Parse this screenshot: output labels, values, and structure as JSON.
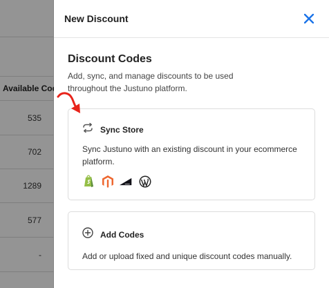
{
  "background": {
    "column_header": "Available Codes",
    "rows": [
      "535",
      "702",
      "1289",
      "577",
      "-"
    ]
  },
  "drawer": {
    "title": "New Discount",
    "close_icon": "close-icon"
  },
  "section": {
    "title": "Discount Codes",
    "description": "Add, sync, and manage discounts to be used throughout the Justuno platform."
  },
  "cards": {
    "sync": {
      "icon": "sync-icon",
      "title": "Sync Store",
      "description": "Sync Justuno with an existing discount in your ecommerce platform.",
      "platforms": [
        "shopify-icon",
        "magento-icon",
        "bigcommerce-icon",
        "wordpress-icon"
      ]
    },
    "add": {
      "icon": "plus-circle-icon",
      "title": "Add Codes",
      "description": "Add or upload fixed and unique discount codes manually."
    }
  },
  "colors": {
    "accent": "#1a73e8",
    "annotation_arrow": "#e8231a",
    "shopify": "#95bf47",
    "magento": "#ee672f",
    "bigcommerce": "#121118",
    "wordpress": "#222222"
  }
}
